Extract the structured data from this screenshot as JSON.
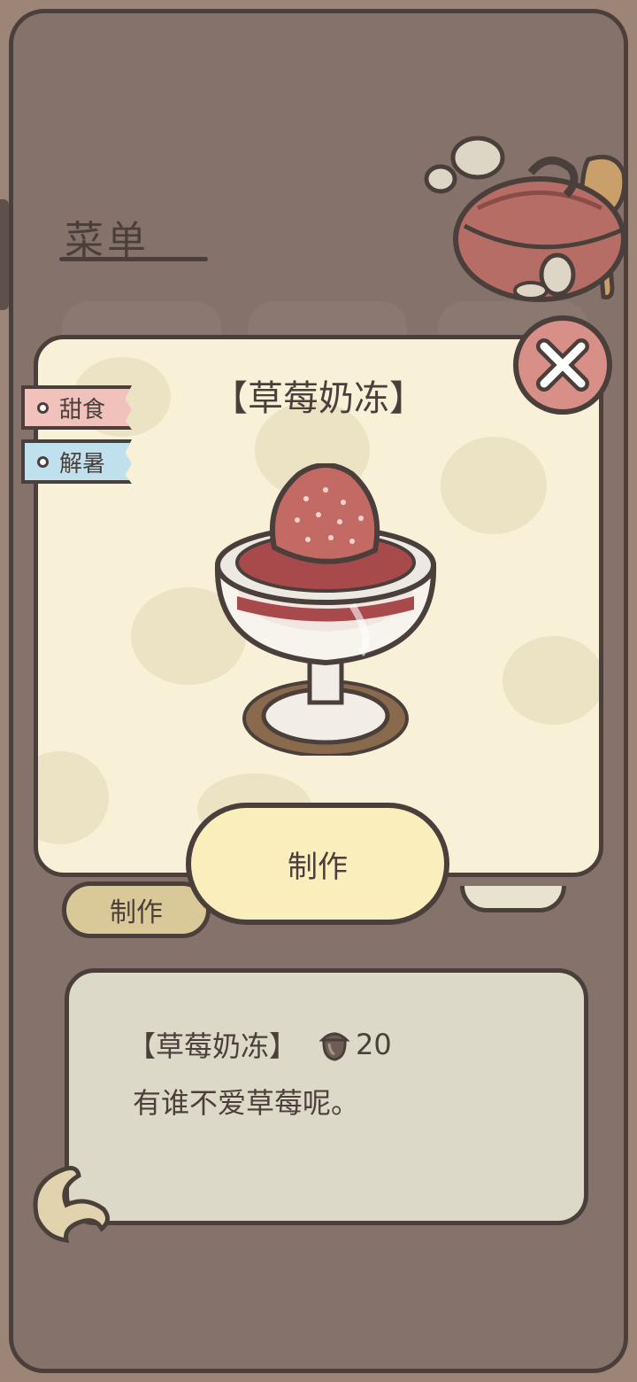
{
  "menu": {
    "title": "菜单",
    "make_label": "制作"
  },
  "modal": {
    "title": "【草莓奶冻】",
    "tags": [
      {
        "label": "甜食",
        "color": "#f1c1bb"
      },
      {
        "label": "解暑",
        "color": "#bfe0ec"
      }
    ],
    "make_button": "制作",
    "close_icon": "close-x-icon"
  },
  "description": {
    "name": "【草莓奶冻】",
    "cost_icon": "acorn-icon",
    "cost": "20",
    "text": "有谁不爱草莓呢。"
  },
  "colors": {
    "background": "#85736b",
    "outline": "#4a3f3b",
    "modal_bg": "#f8f1d8",
    "button_bg": "#fbeebd",
    "close_bg": "#d88f87"
  }
}
